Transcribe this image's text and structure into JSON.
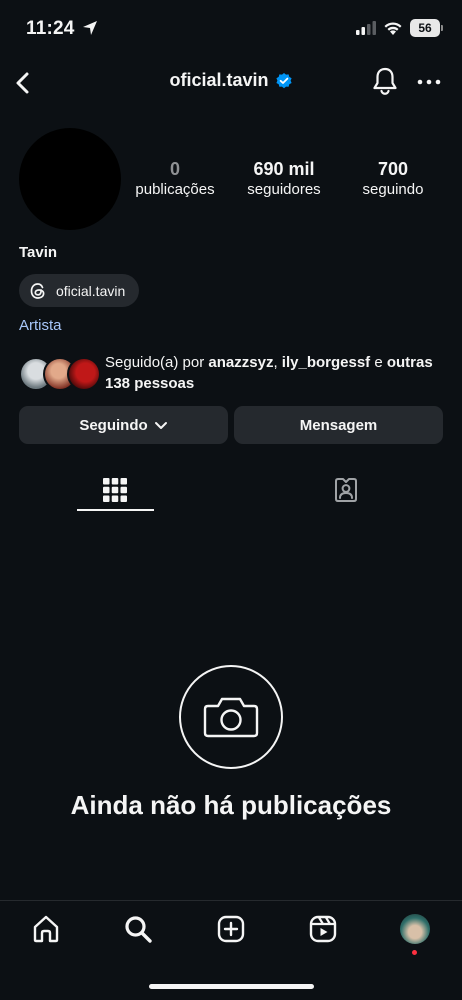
{
  "status_bar": {
    "time": "11:24",
    "battery": "56"
  },
  "header": {
    "username": "oficial.tavin",
    "verified": true,
    "accent_color": "#0095f6"
  },
  "profile": {
    "stats": [
      {
        "value": "0",
        "label": "publicações"
      },
      {
        "value": "690 mil",
        "label": "seguidores"
      },
      {
        "value": "700",
        "label": "seguindo"
      }
    ],
    "display_name": "Tavin",
    "threads_handle": "oficial.tavin",
    "category": "Artista",
    "followed_by": {
      "prefix": "Seguido(a) por ",
      "user1": "anazzsyz",
      "separator": ", ",
      "user2": "ily_borgessf",
      "conjunction": " e ",
      "others": "outras 138 pessoas"
    }
  },
  "actions": {
    "following_label": "Seguindo",
    "message_label": "Mensagem"
  },
  "tabs": [
    {
      "icon": "grid-icon",
      "active": true
    },
    {
      "icon": "tagged-icon",
      "active": false
    }
  ],
  "empty_state": {
    "icon": "camera-icon",
    "text": "Ainda não há publicações"
  },
  "bottom_nav": [
    {
      "icon": "home-icon"
    },
    {
      "icon": "search-icon"
    },
    {
      "icon": "create-icon"
    },
    {
      "icon": "reels-icon"
    },
    {
      "icon": "profile-avatar"
    }
  ]
}
